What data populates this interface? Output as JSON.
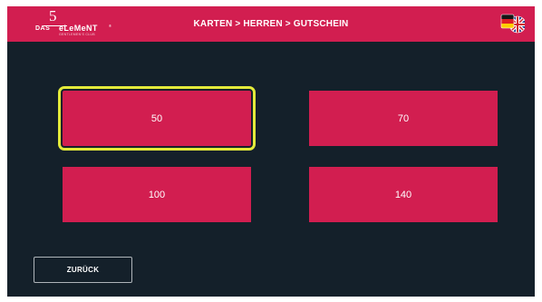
{
  "header": {
    "logo": {
      "icon": "das-5-element-logo",
      "text_5": "5",
      "text_das": "DAS",
      "text_element": "eLeMeNT",
      "text_tm": "®",
      "text_club": "GENTLEMEN'S CLUB"
    },
    "breadcrumb": "KARTEN > HERREN > GUTSCHEIN",
    "language_icon": "german-uk-flag-icon"
  },
  "amounts": [
    {
      "label": "50",
      "selected": true
    },
    {
      "label": "70",
      "selected": false
    },
    {
      "label": "100",
      "selected": false
    },
    {
      "label": "140",
      "selected": false
    }
  ],
  "footer": {
    "back_label": "ZURÜCK"
  },
  "colors": {
    "background": "#14202a",
    "header": "#d21e50",
    "button": "#d21e50",
    "selection_outline": "#e3ea3a",
    "back_border": "#aeb4b9"
  }
}
